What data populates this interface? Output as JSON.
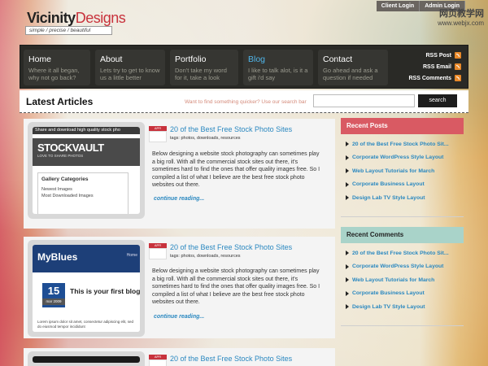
{
  "brand": {
    "name_part1": "Vicinity",
    "name_part2": "Designs",
    "tagline": "simple / precise / beautiful"
  },
  "topbar": {
    "login": "Client Login",
    "admin": "Admin Login"
  },
  "watermark": {
    "line1": "网页教学网",
    "line2": "www.webjx.com"
  },
  "nav": [
    {
      "title": "Home",
      "desc": "Where it all began, why not go back?"
    },
    {
      "title": "About",
      "desc": "Lets try to get to know us a little better"
    },
    {
      "title": "Portfolio",
      "desc": "Don't take my word for it, take a look"
    },
    {
      "title": "Blog",
      "desc": "I like to talk alot, is it a gift i'd say"
    },
    {
      "title": "Contact",
      "desc": "Go ahead and ask a question if needed"
    }
  ],
  "rss": {
    "post": "RSS Post",
    "email": "RSS Email",
    "comments": "RSS Comments"
  },
  "latest": {
    "title": "Latest Articles",
    "search_prompt": "Want to find something quicker?  Use our search bar",
    "search_placeholder": "",
    "search_button": "search"
  },
  "articles": [
    {
      "date_tab": "APR",
      "title": "20 of the Best Free Stock Photo Sites",
      "tags": "tags: photos, downloads, resources",
      "body": "Below designing a website stock photography can sometimes play a big roll. With all the commercial stock sites out there, it's sometimes hard to find the ones that offer quality images free. So I compiled a list of what I believe are the best free stock photo websites out there.",
      "more": "continue reading...",
      "thumb": {
        "top": "Share and download high quality stock pho",
        "name": "STOCKVAULT",
        "sub": "LOVE TO SHARE PHOTOS",
        "box_heading": "Gallery Categories",
        "items": [
          "Newest Images",
          "Most Downloaded Images"
        ]
      }
    },
    {
      "date_tab": "APR",
      "title": "20 of the Best Free Stock Photo Sites",
      "tags": "tags: photos, downloads, resources",
      "body": "Below designing a website stock photography can sometimes play a big roll. With all the commercial stock sites out there, it's sometimes hard to find the ones that offer quality images free. So I compiled a list of what I believe are the best free stock photo websites out there.",
      "more": "continue reading...",
      "thumb": {
        "name": "MyBlues",
        "home": "Home",
        "day": "15",
        "month": "mar 2009",
        "post": "This is your first blog",
        "lorem": "Lorem ipsum dolor sit amet, consectetur adipiscing elit, sed do eiusmod tempor incididunt"
      }
    },
    {
      "date_tab": "APR",
      "title": "20 of the Best Free Stock Photo Sites"
    }
  ],
  "sidebar": {
    "recent_posts_title": "Recent Posts",
    "recent_posts": [
      "20 of the Best Free Stock Photo Sit...",
      "Corporate WordPress Style Layout",
      "Web Layout Tutorials for March",
      "Corporate Business Layout",
      "Design Lab TV Style Layout"
    ],
    "recent_comments_title": "Recent Comments",
    "recent_comments": [
      "20 of the Best Free Stock Photo Sit...",
      "Corporate WordPress Style Layout",
      "Web Layout Tutorials for March",
      "Corporate Business Layout",
      "Design Lab TV Style Layout"
    ]
  },
  "colors": {
    "brand_red": "#c8323c",
    "link_blue": "#2a88c0",
    "nav_bg": "#2a2a26",
    "rss_orange": "#e8892a"
  }
}
